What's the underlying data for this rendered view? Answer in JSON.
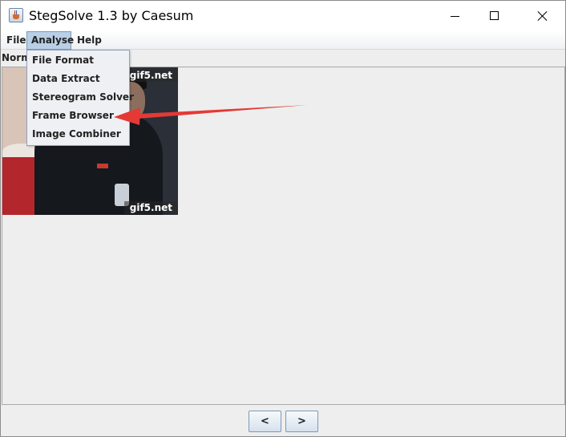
{
  "window": {
    "title": "StegSolve 1.3 by Caesum",
    "app_icon": "java-cup-icon"
  },
  "window_controls": {
    "minimize_icon": "minimize-icon",
    "maximize_icon": "maximize-icon",
    "close_icon": "close-icon"
  },
  "menubar": {
    "items": [
      {
        "label": "File"
      },
      {
        "label": "Analyse"
      },
      {
        "label": "Help"
      }
    ]
  },
  "analyse_menu": {
    "items": [
      {
        "label": "File Format"
      },
      {
        "label": "Data Extract"
      },
      {
        "label": "Stereogram Solver"
      },
      {
        "label": "Frame Browser"
      },
      {
        "label": "Image Combiner"
      }
    ]
  },
  "view": {
    "mode_label": "Norm"
  },
  "image": {
    "watermark_top": "gif5.net",
    "watermark_bottom": "gif5.net"
  },
  "nav": {
    "prev_label": "<",
    "next_label": ">"
  },
  "colors": {
    "annotation_arrow": "#e53935",
    "menu_highlight": "#b8cfe5"
  }
}
